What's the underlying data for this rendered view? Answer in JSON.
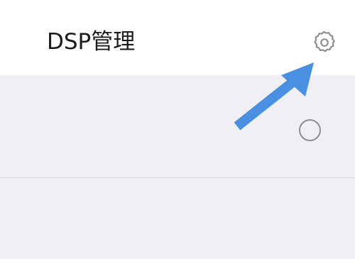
{
  "header": {
    "title": "DSP管理",
    "settings_icon": "gear-icon"
  },
  "list": {
    "rows": [
      {
        "selected": false
      }
    ]
  },
  "annotation": {
    "type": "arrow",
    "color": "#4a90e2",
    "points_to": "settings-button"
  },
  "colors": {
    "header_bg": "#ffffff",
    "page_bg": "#efeff4",
    "title_text": "#1c1c1e",
    "icon": "#8e8e93",
    "arrow": "#4a90e2"
  }
}
